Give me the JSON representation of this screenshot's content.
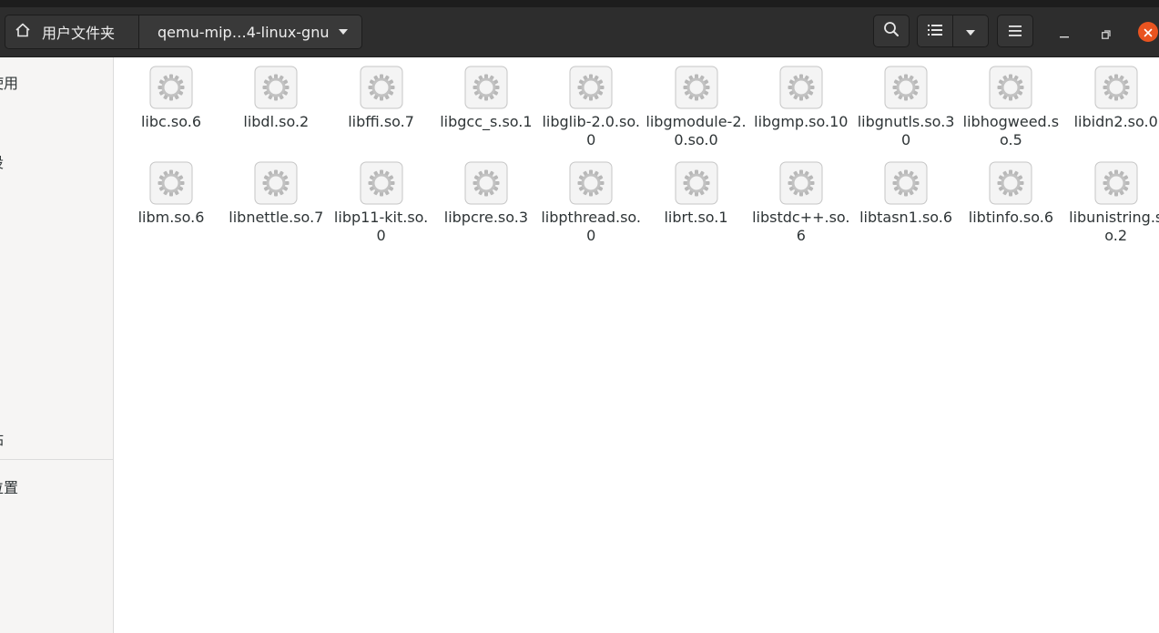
{
  "header": {
    "home_label": "用户文件夹",
    "current_folder": "qemu-mip…4-linux-gnu"
  },
  "sidebar": {
    "items": [
      {
        "label": "使用"
      },
      {
        "label": "设"
      },
      {
        "label": "站"
      },
      {
        "label": "位置"
      }
    ]
  },
  "files": [
    {
      "name": "libc.so.6"
    },
    {
      "name": "libdl.so.2"
    },
    {
      "name": "libffi.so.7"
    },
    {
      "name": "libgcc_s.so.1"
    },
    {
      "name": "libglib-2.0.so.0"
    },
    {
      "name": "libgmodule-2.0.so.0"
    },
    {
      "name": "libgmp.so.10"
    },
    {
      "name": "libgnutls.so.30"
    },
    {
      "name": "libhogweed.so.5"
    },
    {
      "name": "libidn2.so.0"
    },
    {
      "name": "libm.so.6"
    },
    {
      "name": "libnettle.so.7"
    },
    {
      "name": "libp11-kit.so.0"
    },
    {
      "name": "libpcre.so.3"
    },
    {
      "name": "libpthread.so.0"
    },
    {
      "name": "librt.so.1"
    },
    {
      "name": "libstdc++.so.6"
    },
    {
      "name": "libtasn1.so.6"
    },
    {
      "name": "libtinfo.so.6"
    },
    {
      "name": "libunistring.so.2"
    }
  ],
  "colors": {
    "accent": "#e95420",
    "headerbar": "#2d2d2d",
    "sidebar": "#f6f5f4"
  },
  "icons": {
    "home": "home-icon",
    "dropdown": "chevron-down-icon",
    "search": "search-icon",
    "list_view": "list-view-icon",
    "menu": "hamburger-menu-icon",
    "file": "shared-library-gear-icon"
  }
}
